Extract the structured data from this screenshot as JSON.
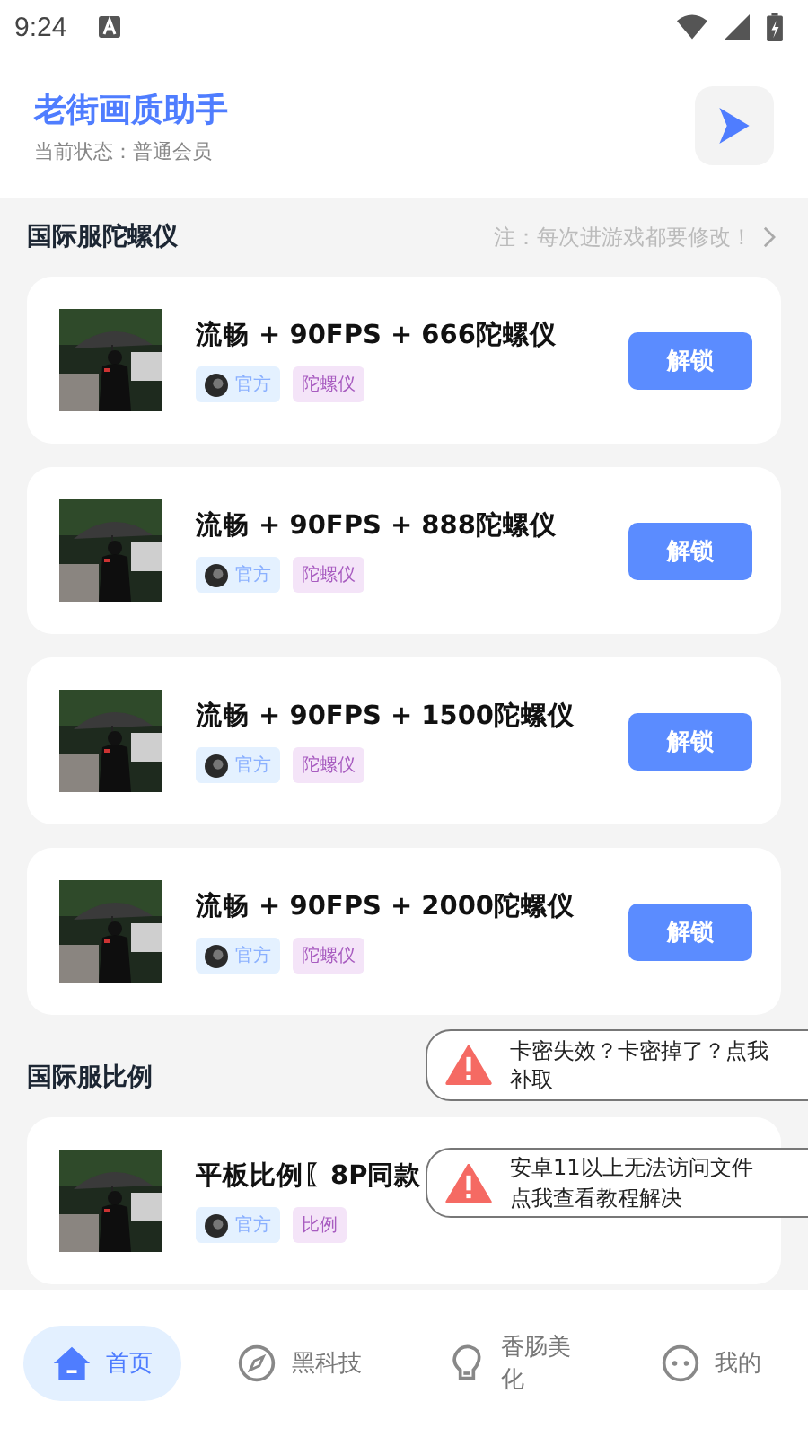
{
  "status_bar": {
    "time": "9:24"
  },
  "header": {
    "title": "老街画质助手",
    "subtitle": "当前状态：普通会员"
  },
  "sections": [
    {
      "title": "国际服陀螺仪",
      "note": "注：每次进游戏都要修改！",
      "items": [
        {
          "title": "流畅 + 90FPS + 666陀螺仪",
          "tags": [
            "官方",
            "陀螺仪"
          ],
          "button": "解锁"
        },
        {
          "title": "流畅 + 90FPS + 888陀螺仪",
          "tags": [
            "官方",
            "陀螺仪"
          ],
          "button": "解锁"
        },
        {
          "title": "流畅 + 90FPS + 1500陀螺仪",
          "tags": [
            "官方",
            "陀螺仪"
          ],
          "button": "解锁"
        },
        {
          "title": "流畅 + 90FPS + 2000陀螺仪",
          "tags": [
            "官方",
            "陀螺仪"
          ],
          "button": "解锁"
        }
      ]
    },
    {
      "title": "国际服比例",
      "items": [
        {
          "title": "平板比例〖8P同款",
          "tags": [
            "官方",
            "比例"
          ]
        }
      ]
    }
  ],
  "toasts": [
    {
      "lines": [
        "卡密失效？卡密掉了？点我",
        "补取"
      ]
    },
    {
      "lines": [
        "安卓11以上无法访问文件",
        "点我查看教程解决"
      ]
    }
  ],
  "nav": [
    {
      "label": "首页",
      "selected": true
    },
    {
      "label": "黑科技",
      "selected": false
    },
    {
      "label": "香肠美化",
      "selected": false
    },
    {
      "label": "我的",
      "selected": false
    }
  ]
}
